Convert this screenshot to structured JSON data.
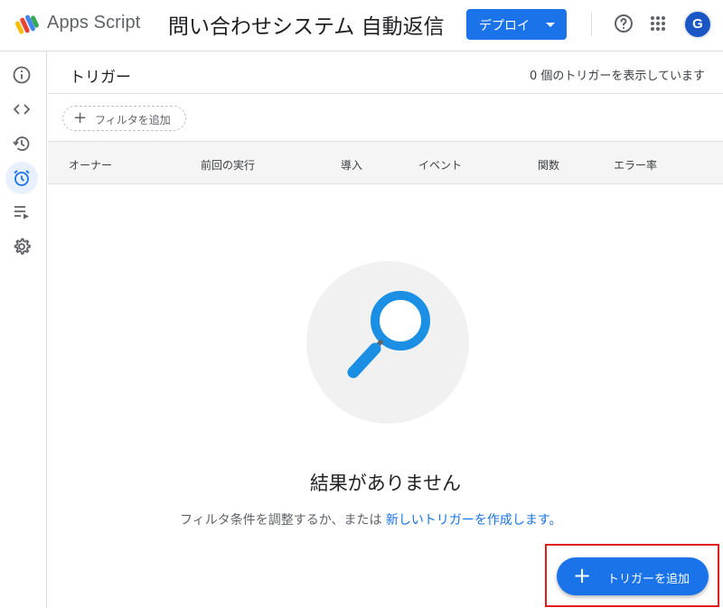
{
  "header": {
    "brand": "Apps Script",
    "project_title": "問い合わせシステム 自動返信",
    "deploy_label": "デプロイ",
    "avatar_letter": "G"
  },
  "sidebar": {
    "items": [
      {
        "icon": "info-icon",
        "active": false
      },
      {
        "icon": "code-icon",
        "active": false
      },
      {
        "icon": "history-icon",
        "active": false
      },
      {
        "icon": "alarm-clock-icon",
        "active": true
      },
      {
        "icon": "playlist-run-icon",
        "active": false
      },
      {
        "icon": "gear-icon",
        "active": false
      }
    ]
  },
  "main": {
    "title": "トリガー",
    "count_text": "0 個のトリガーを表示しています",
    "filter_label": "フィルタを追加",
    "columns": [
      "オーナー",
      "前回の実行",
      "導入",
      "イベント",
      "関数",
      "エラー率"
    ],
    "empty_title": "結果がありません",
    "empty_text_prefix": "フィルタ条件を調整するか、または ",
    "empty_link": "新しいトリガーを作成します。",
    "add_trigger_label": "トリガーを追加"
  },
  "colors": {
    "accent": "#1a73e8",
    "highlight": "#e21b1b",
    "magnifier": "#1a8fe3"
  }
}
